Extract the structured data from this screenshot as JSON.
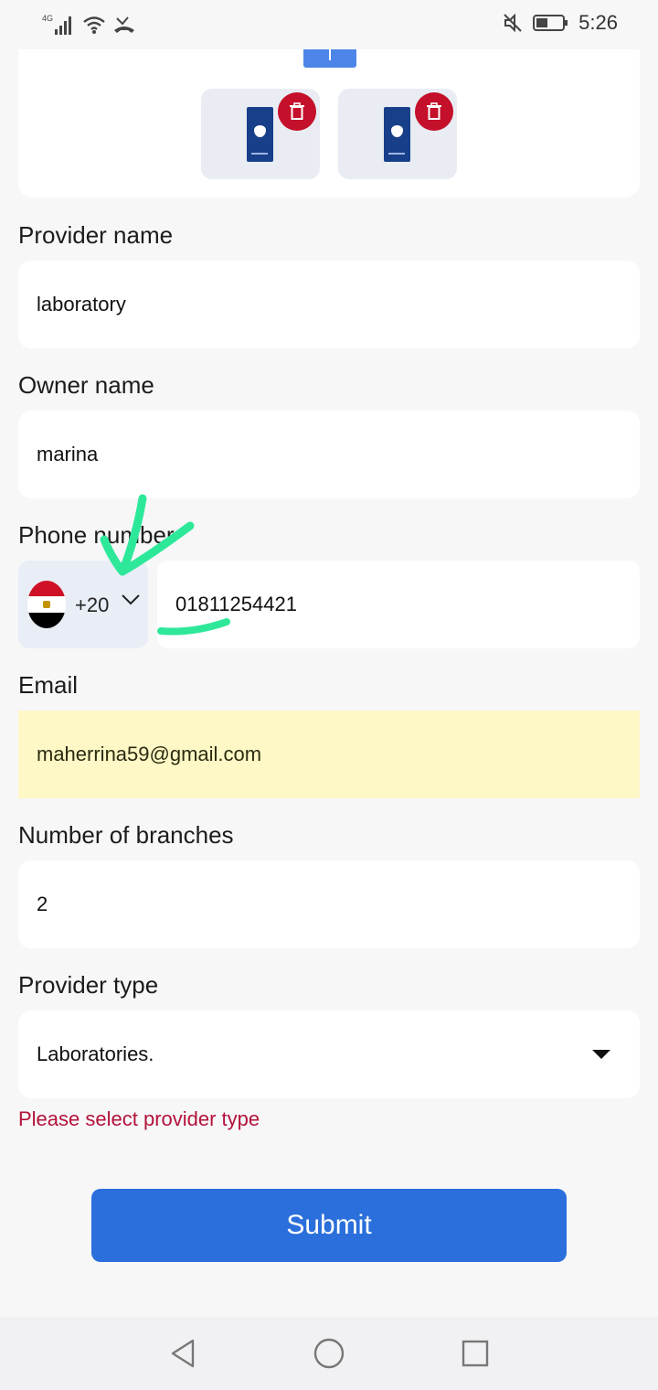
{
  "status_bar": {
    "network_label": "4G",
    "time": "5:26",
    "icons": [
      "signal-icon",
      "wifi-icon",
      "missed-call-icon",
      "mute-icon",
      "battery-icon"
    ]
  },
  "upload": {
    "thumbnails": [
      {
        "name": "thumbnail-1",
        "delete_icon": "trash-icon"
      },
      {
        "name": "thumbnail-2",
        "delete_icon": "trash-icon"
      }
    ]
  },
  "form": {
    "provider_name": {
      "label": "Provider name",
      "value": "laboratory"
    },
    "owner_name": {
      "label": "Owner name",
      "value": "marina"
    },
    "phone": {
      "label": "Phone number",
      "country_code": "+20",
      "country_flag": "egypt-flag-icon",
      "value": "01811254421"
    },
    "email": {
      "label": "Email",
      "value": "maherrina59@gmail.com"
    },
    "branches": {
      "label": "Number of branches",
      "value": "2"
    },
    "provider_type": {
      "label": "Provider type",
      "value": "Laboratories.",
      "error": "Please select provider type"
    }
  },
  "submit_label": "Submit",
  "nav": [
    "back-icon",
    "home-icon",
    "recents-icon"
  ],
  "colors": {
    "accent": "#2a6fdb",
    "error": "#b3123a",
    "delete_badge": "#c4102a",
    "autofill": "#fdf8c6",
    "annotation": "#2ee89a"
  }
}
